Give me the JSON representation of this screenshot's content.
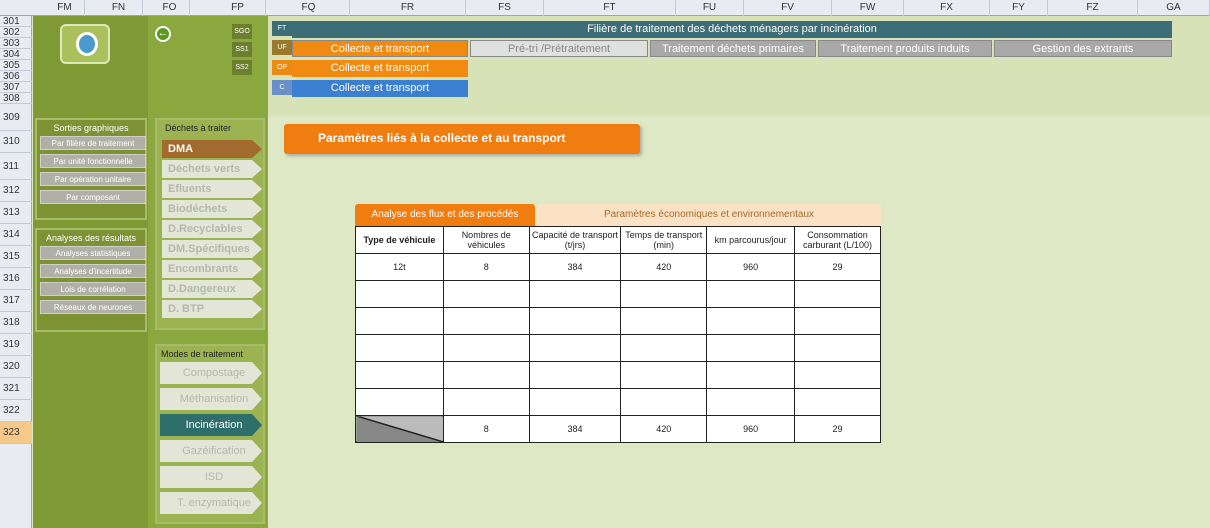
{
  "columns": [
    "FM",
    "FN",
    "FO",
    "FP",
    "FQ",
    "FR",
    "FS",
    "FT",
    "FU",
    "FV",
    "FW",
    "FX",
    "FY",
    "FZ",
    "GA"
  ],
  "rows": [
    "301",
    "302",
    "303",
    "304",
    "305",
    "306",
    "307",
    "308",
    "309",
    "310",
    "311",
    "312",
    "313",
    "314",
    "315",
    "316",
    "317",
    "318",
    "319",
    "320",
    "321",
    "322",
    "323"
  ],
  "tags": {
    "sgo": "SGO",
    "ss1": "SS1",
    "ss2": "SS2",
    "ft": "FT",
    "uf": "UF",
    "op": "OP",
    "c": "C"
  },
  "header": {
    "title": "Filière de traitement des déchets ménagers par incinération",
    "uf_tabs": [
      "Collecte et transport",
      "Pré-tri /Prétraitement",
      "Traitement déchets primaires",
      "Traitement produits induits",
      "Gestion des extrants"
    ],
    "op_label": "Collecte et transport",
    "c_label": "Collecte et transport"
  },
  "sorties": {
    "title": "Sorties graphiques",
    "items": [
      "Par filière de traitement",
      "Par unité fonctionnelle",
      "Par opération unitaire",
      "Par composant"
    ]
  },
  "analyses": {
    "title": "Analyses des résultats",
    "items": [
      "Analyses statistiques",
      "Analyses d'incertitude",
      "Lois de corrélation",
      "Réseaux de neurones"
    ]
  },
  "dechets": {
    "title": "Déchets à traiter",
    "items": [
      "DMA",
      "Déchets verts",
      "Efluents",
      "Biodéchets",
      "D.Recyclables",
      "DM.Spécifiques",
      "Encombrants",
      "D.Dangereux",
      "D. BTP"
    ],
    "active": 0
  },
  "modes": {
    "title": "Modes de traitement",
    "items": [
      "Compostage",
      "Méthanisation",
      "Incinération",
      "Gazéification",
      "ISD",
      "T. enzymatique"
    ],
    "active": 2
  },
  "section_title": "Paramètres liés à la collecte et au transport",
  "tabs": [
    "Analyse des flux et des procédés",
    "Paramètres économiques et environnementaux"
  ],
  "table": {
    "headers": [
      "Type de véhicule",
      "Nombres de véhicules",
      "Capacité de transport (t/jrs)",
      "Temps de transport (min)",
      "km parcourus/jour",
      "Consommation carburant (L/100)"
    ],
    "row1": [
      "12t",
      "8",
      "384",
      "420",
      "960",
      "29"
    ],
    "totals": [
      "8",
      "384",
      "420",
      "960",
      "29"
    ]
  }
}
